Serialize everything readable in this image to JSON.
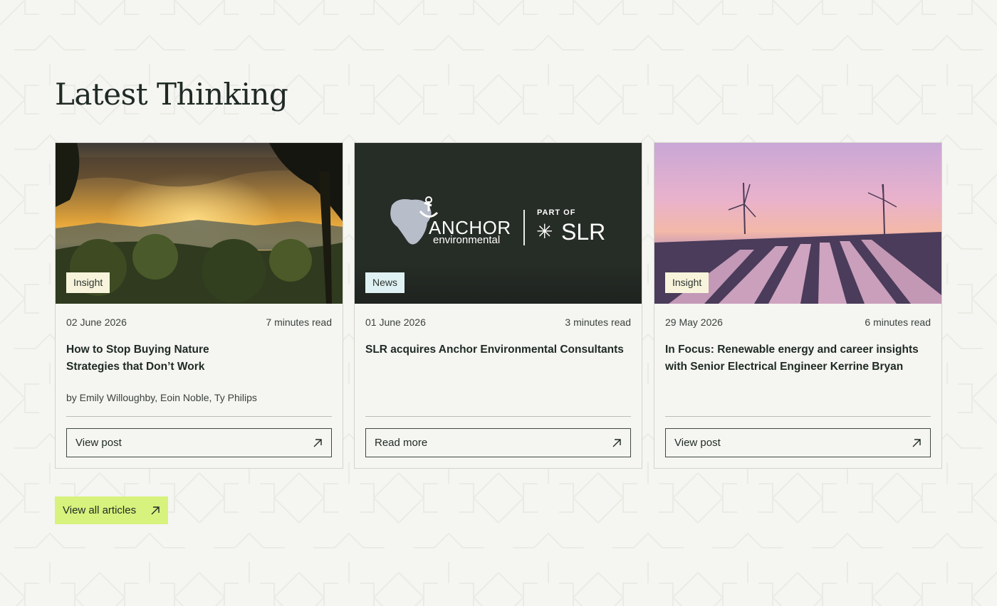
{
  "section": {
    "title": "Latest Thinking",
    "view_all_label": "View all articles"
  },
  "colors": {
    "background": "#f5f5f1",
    "accent_button": "#d7f27d",
    "tag_insight": "#f8f4dc",
    "tag_news": "#dff1f3",
    "text": "#1f2a24"
  },
  "cards": [
    {
      "tag": "Insight",
      "date": "02 June 2026",
      "read_time": "7 minutes read",
      "headline": "How to Stop Buying Nature Strategies that Don’t Work",
      "authors": "by Emily Willoughby, Eoin Noble, Ty Philips",
      "button_label": "View post",
      "image": "sunset-forest-landscape"
    },
    {
      "tag": "News",
      "date": "01 June 2026",
      "read_time": "3 minutes read",
      "headline": "SLR acquires Anchor Environmental Consultants",
      "authors": "",
      "button_label": "Read more",
      "image": "anchor-slr-logo",
      "logo": {
        "brand": "ANCHOR",
        "brand_sub": "environmental",
        "part_of": "PART OF",
        "parent": "SLR"
      }
    },
    {
      "tag": "Insight",
      "date": "29 May 2026",
      "read_time": "6 minutes read",
      "headline": "In Focus: Renewable energy and career insights with Senior Electrical Engineer Kerrine Bryan",
      "authors": "",
      "button_label": "View post",
      "image": "wind-turbines-solar-farm"
    }
  ]
}
